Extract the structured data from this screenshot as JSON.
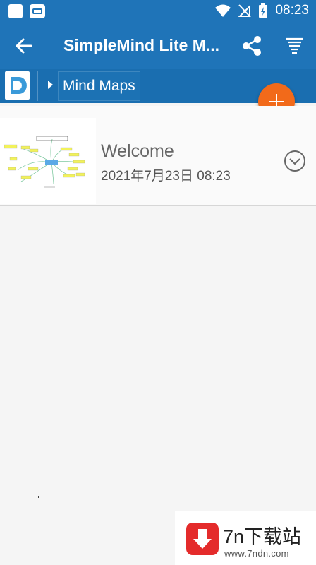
{
  "status_bar": {
    "time": "08:23"
  },
  "app_bar": {
    "title": "SimpleMind Lite M..."
  },
  "breadcrumb": {
    "current": "Mind Maps"
  },
  "list": {
    "items": [
      {
        "name": "Welcome",
        "date": "2021年7月23日 08:23"
      }
    ]
  },
  "watermark": {
    "title": "7n下载站",
    "url": "www.7ndn.com"
  },
  "colors": {
    "primary": "#1f74b8",
    "accent": "#f26a1a"
  },
  "icons": [
    "back-arrow-icon",
    "share-icon",
    "sort-icon",
    "simplemind-logo-icon",
    "add-icon",
    "chevron-down-icon",
    "download-icon"
  ]
}
